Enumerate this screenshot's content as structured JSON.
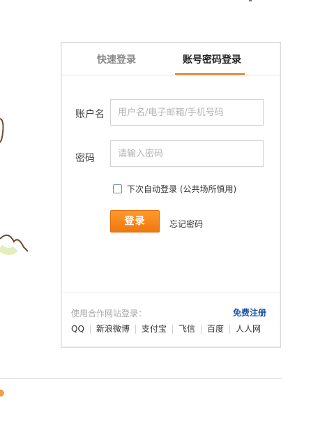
{
  "tabs": {
    "quick": "快速登录",
    "account": "账号密码登录"
  },
  "form": {
    "username_label": "账户名",
    "username_placeholder": "用户名/电子邮箱/手机号码",
    "password_label": "密码",
    "password_placeholder": "请输入密码",
    "remember_label": "下次自动登录 (公共场所慎用)",
    "login_button": "登录",
    "forgot_link": "忘记密码"
  },
  "footer": {
    "partner_label": "使用合作网站登录：",
    "register_link": "免费注册",
    "partners": [
      "QQ",
      "新浪微博",
      "支付宝",
      "飞信",
      "百度",
      "人人网"
    ]
  },
  "colors": {
    "accent": "#f26d12",
    "link_blue": "#1a4fa8"
  }
}
